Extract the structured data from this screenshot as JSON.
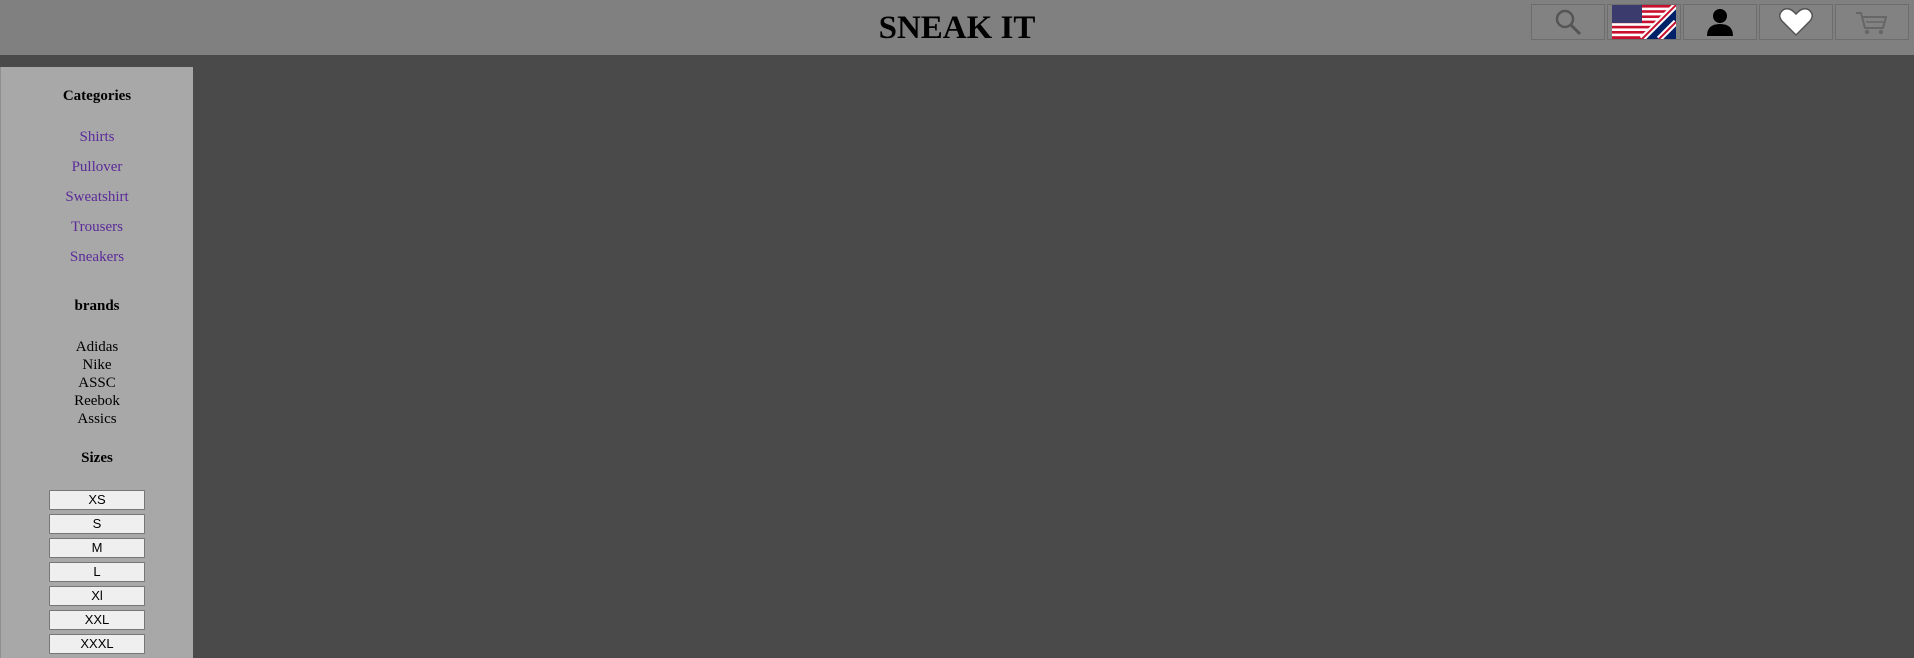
{
  "header": {
    "title": "SNEAK IT",
    "icons": [
      "search-icon",
      "language-flag-icon",
      "user-icon",
      "heart-icon",
      "cart-icon"
    ]
  },
  "sidebar": {
    "categories_heading": "Categories",
    "categories": [
      "Shirts",
      "Pullover",
      "Sweatshirt",
      "Trousers",
      "Sneakers"
    ],
    "brands_heading": "brands",
    "brands": [
      "Adidas",
      "Nike",
      "ASSC",
      "Reebok",
      "Assics"
    ],
    "sizes_heading": "Sizes",
    "sizes": [
      "XS",
      "S",
      "M",
      "L",
      "Xl",
      "XXL",
      "XXXL"
    ]
  },
  "colors": {
    "header_bg": "#808080",
    "sidebar_bg": "#a8a8a8",
    "content_bg": "#4a4a4a",
    "link": "#5b2a99"
  }
}
